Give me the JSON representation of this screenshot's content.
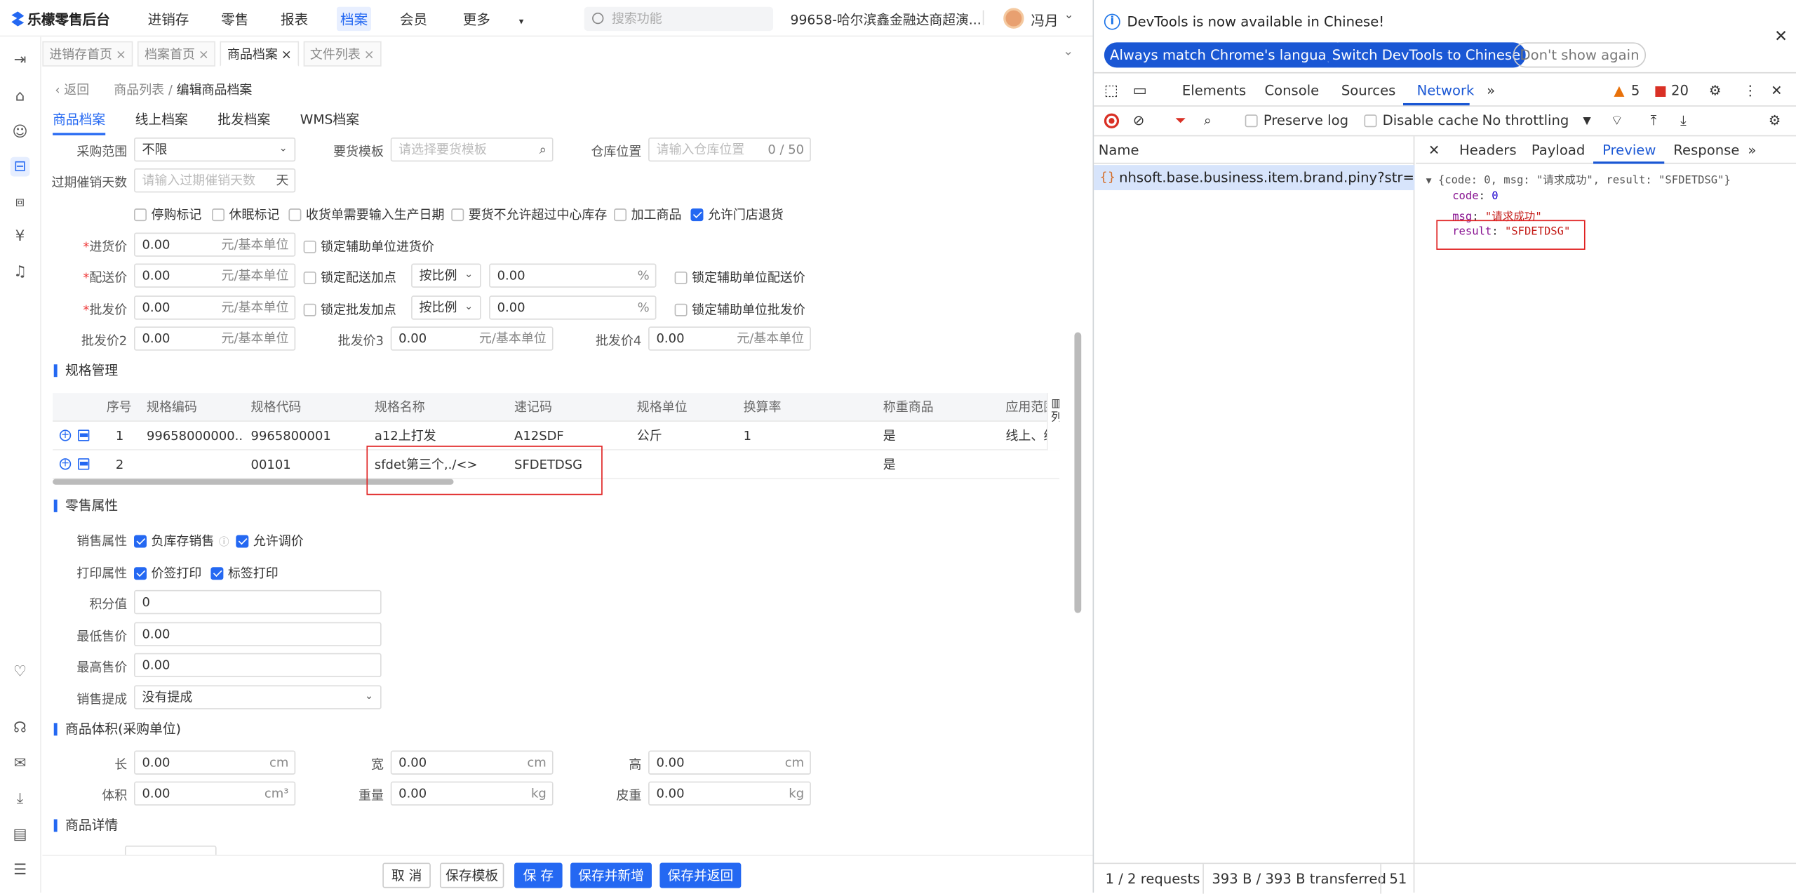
{
  "app": {
    "logo": "乐檬零售后台",
    "nav": [
      "进销存",
      "零售",
      "报表",
      "档案",
      "会员",
      "更多"
    ],
    "nav_active": "档案",
    "search_placeholder": "搜索功能",
    "store": "99658-哈尔滨鑫金融达商超演...",
    "user": "冯月",
    "tabs": [
      "进销存首页",
      "档案首页",
      "商品档案",
      "文件列表"
    ],
    "tab_active": "商品档案",
    "crumb_back": "返回",
    "crumb_list": "商品列表",
    "crumb_sep": "/",
    "crumb_current": "编辑商品档案",
    "subtabs": [
      "商品档案",
      "线上档案",
      "批发档案",
      "WMS档案"
    ],
    "form": {
      "purchase_range_label": "采购范围",
      "purchase_range_value": "不限",
      "order_template_label": "要货模板",
      "order_template_placeholder": "请选择要货模板",
      "warehouse_label": "仓库位置",
      "warehouse_placeholder": "请输入仓库位置",
      "warehouse_count": "0 / 50",
      "expiry_label": "过期催销天数",
      "expiry_placeholder": "请输入过期催销天数",
      "expiry_unit": "天",
      "flags": [
        {
          "label": "停购标记",
          "checked": false
        },
        {
          "label": "休眠标记",
          "checked": false
        },
        {
          "label": "收货单需要输入生产日期",
          "checked": false
        },
        {
          "label": "要货不允许超过中心库存",
          "checked": false
        },
        {
          "label": "加工商品",
          "checked": false
        },
        {
          "label": "允许门店退货",
          "checked": true
        }
      ],
      "purchase_price_label": "进货价",
      "purchase_price": "0.00",
      "price_unit": "元/基本单位",
      "lock_aux_purchase": "锁定辅助单位进货价",
      "dist_price_label": "配送价",
      "dist_price": "0.00",
      "lock_dist_markup": "锁定配送加点",
      "ratio_select": "按比例",
      "dist_ratio": "0.00",
      "pct": "%",
      "lock_aux_dist": "锁定辅助单位配送价",
      "whole_price_label": "批发价",
      "whole_price": "0.00",
      "lock_whole_markup": "锁定批发加点",
      "whole_ratio": "0.00",
      "lock_aux_whole": "锁定辅助单位批发价",
      "wp2_label": "批发价2",
      "wp2": "0.00",
      "wp3_label": "批发价3",
      "wp3": "0.00",
      "wp4_label": "批发价4",
      "wp4": "0.00"
    },
    "spec_section": "规格管理",
    "spec_headers": [
      "序号",
      "规格编码",
      "规格代码",
      "规格名称",
      "速记码",
      "规格单位",
      "换算率",
      "称重商品",
      "应用范围"
    ],
    "spec_rows": [
      [
        "1",
        "99658000000...",
        "9965800001",
        "a12上打发",
        "A12SDF",
        "公斤",
        "1",
        "是",
        "线上、线"
      ],
      [
        "2",
        "",
        "00101",
        "sfdet第三个,./<>",
        "SFDETDSG",
        "",
        "",
        "是",
        ""
      ]
    ],
    "col_settings": "列",
    "retail_section": "零售属性",
    "sale_attr_label": "销售属性",
    "neg_stock": "负库存销售",
    "allow_price_adj": "允许调价",
    "print_attr_label": "打印属性",
    "price_tag_print": "价签打印",
    "label_print": "标签打印",
    "points_label": "积分值",
    "points": "0",
    "min_price_label": "最低售价",
    "min_price": "0.00",
    "max_price_label": "最高售价",
    "max_price": "0.00",
    "commission_label": "销售提成",
    "commission": "没有提成",
    "volume_section": "商品体积(采购单位)",
    "len_label": "长",
    "width_label": "宽",
    "height_label": "高",
    "vol_label": "体积",
    "weight_label": "重量",
    "tare_label": "皮重",
    "dim_value": "0.00",
    "cm": "cm",
    "cm3": "cm³",
    "kg": "kg",
    "detail_section": "商品详情",
    "footer_buttons": [
      "取 消",
      "保存模板",
      "保 存",
      "保存并新增",
      "保存并返回"
    ]
  },
  "devtools": {
    "notice": "DevTools is now available in Chinese!",
    "btn_match": "Always match Chrome's language",
    "btn_switch": "Switch DevTools to Chinese",
    "btn_dismiss": "Don't show again",
    "tabs": [
      "Elements",
      "Console",
      "Sources",
      "Network"
    ],
    "tab_active": "Network",
    "warn_count": "5",
    "err_count": "20",
    "preserve_log": "Preserve log",
    "disable_cache": "Disable cache",
    "throttling": "No throttling",
    "name_header": "Name",
    "request": "nhsoft.base.business.item.brand.piny?str=sf...",
    "detail_tabs": [
      "Headers",
      "Payload",
      "Preview",
      "Response"
    ],
    "detail_active": "Preview",
    "json_summary": "{code: 0, msg: \"请求成功\", result: \"SFDETDSG\"}",
    "code_key": "code",
    "code_val": "0",
    "msg_key": "msg",
    "msg_val": "\"请求成功\"",
    "result_key": "result",
    "result_val": "\"SFDETDSG\"",
    "requests": "1 / 2 requests",
    "transferred": "393 B / 393 B transferred",
    "extra": "51"
  }
}
